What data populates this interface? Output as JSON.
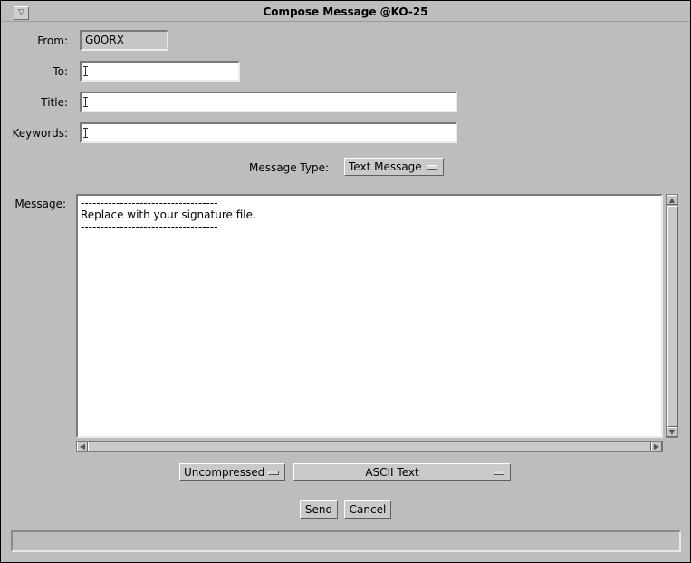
{
  "window": {
    "title": "Compose Message @KO-25"
  },
  "form": {
    "from_label": "From:",
    "from_value": "G0ORX",
    "to_label": "To:",
    "to_value": "",
    "title_label": "Title:",
    "title_value": "",
    "keywords_label": "Keywords:",
    "keywords_value": "",
    "message_type_label": "Message Type:",
    "message_type_value": "Text Message",
    "message_label": "Message:",
    "message_body": "-----------------------------------\nReplace with your signature file.\n-----------------------------------"
  },
  "options": {
    "compression": "Uncompressed",
    "encoding": "ASCII Text"
  },
  "buttons": {
    "send": "Send",
    "cancel": "Cancel"
  },
  "status": {
    "text": ""
  },
  "icons": {
    "window_menu": "triangle-down-icon",
    "scroll_up": "arrow-up-icon",
    "scroll_down": "arrow-down-icon",
    "scroll_left": "arrow-left-icon",
    "scroll_right": "arrow-right-icon",
    "dropdown": "dropdown-mark-icon"
  }
}
